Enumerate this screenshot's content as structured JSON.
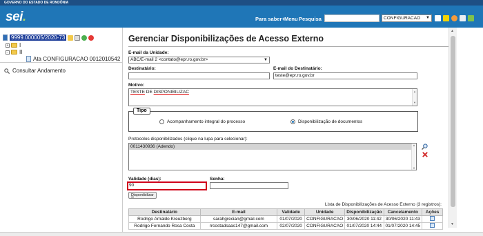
{
  "top_strip": {
    "title": "GOVERNO DO ESTADO DE RONDÔNIA"
  },
  "header": {
    "logo": "sei",
    "logo_dot": ".",
    "links": [
      "Para saber+",
      "Menu",
      "Pesquisa"
    ],
    "search_value": "",
    "unit_select": "CONFIGURACAO",
    "icons": [
      "grid-icon",
      "notification-icon",
      "user-icon",
      "settings-icon",
      "exit-icon"
    ]
  },
  "sidebar": {
    "process_number": "9999.000005/2020-73",
    "tree": [
      {
        "label": "I"
      },
      {
        "label": "II"
      }
    ],
    "document": "Ata CONFIGURACAO 0012010542",
    "consult": "Consultar Andamento"
  },
  "main": {
    "title": "Gerenciar Disponibilizações de Acesso Externo",
    "email_unidade_label": "E-mail da Unidade:",
    "email_unidade_value": "ABC/E-mail 2 <contato@epr.ro.gov.br>",
    "destinatario_label": "Destinatário:",
    "destinatario_value": "",
    "email_destinatario_label": "E-mail do Destinatário:",
    "email_destinatario_value": "teste@epr.ro.gov.br",
    "motivo_label": "Motivo:",
    "motivo_word1": "TESTE",
    "motivo_word2": "DE",
    "motivo_word3": "DISPONIBILIZAC",
    "tipo_legend": "Tipo",
    "tipo_options": [
      "Acompanhamento integral do processo",
      "Disponibilização de documentos"
    ],
    "tipo_selected": 1,
    "protocolos_label": "Protocolos disponibilizados (clique na lupa para selecionar):",
    "protocolos_items": [
      "0011430936 (Adendo)"
    ],
    "validade_label": "Validade (dias):",
    "validade_value": "90",
    "senha_label": "Senha:",
    "senha_value": "",
    "button_first": "D",
    "button_rest": "isponibilizar"
  },
  "table": {
    "caption": "Lista de Disponibilizações de Acesso Externo (3 registros):",
    "headers": [
      "Destinatário",
      "E-mail",
      "Validade",
      "Unidade",
      "Disponibilização",
      "Cancelamento",
      "Ações"
    ],
    "rows": [
      [
        "Rodrigo Arnaldo Kreuzberg",
        "sarahgrecian@gmail.com",
        "01/07/2020",
        "CONFIGURACAO",
        "30/06/2020 11:42",
        "30/06/2020 11:43"
      ],
      [
        "Rodrigo Fernando Rosa Costa",
        "rrcostadsaas147@gmail.com",
        "02/07/2020",
        "CONFIGURACAO",
        "01/07/2020 14:44",
        "01/07/2020 14:45"
      ]
    ]
  },
  "colors": {
    "header": "#1f76b7",
    "strip": "#1e4f84",
    "validade_border": "#d0021b"
  }
}
